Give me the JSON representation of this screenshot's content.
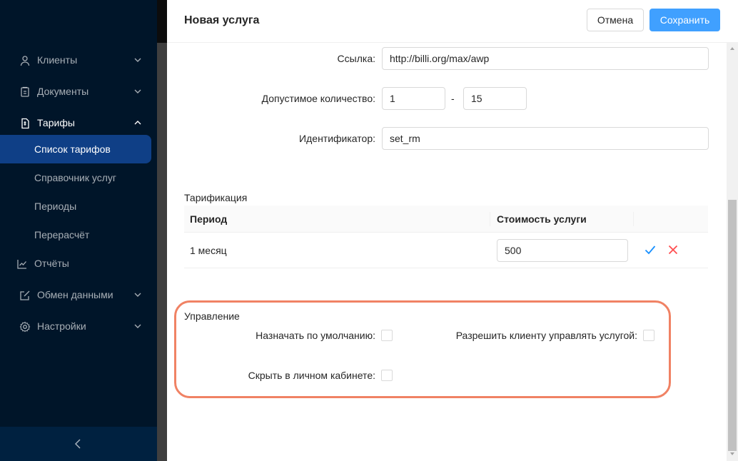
{
  "sidebar": {
    "items": [
      {
        "label": "Клиенты",
        "icon": "user-icon"
      },
      {
        "label": "Документы",
        "icon": "document-icon"
      },
      {
        "label": "Тарифы",
        "icon": "tariff-icon"
      },
      {
        "label": "Отчёты",
        "icon": "chart-icon"
      },
      {
        "label": "Обмен данными",
        "icon": "edit-icon"
      },
      {
        "label": "Настройки",
        "icon": "gear-icon"
      }
    ],
    "sub_items": [
      {
        "label": "Список тарифов",
        "active": true
      },
      {
        "label": "Справочник услуг"
      },
      {
        "label": "Периоды"
      },
      {
        "label": "Перерасчёт"
      }
    ],
    "collapse_icon": "chevron-left-icon"
  },
  "drawer": {
    "title": "Новая услуга",
    "cancel_label": "Отмена",
    "save_label": "Сохранить"
  },
  "form": {
    "link_label": "Ссылка:",
    "link_value": "http://billi.org/max/awp",
    "qty_label": "Допустимое количество:",
    "qty_min": "1",
    "qty_sep": "-",
    "qty_max": "15",
    "id_label": "Идентификатор:",
    "id_value": "set_rm"
  },
  "tariffing": {
    "title": "Тарификация",
    "columns": [
      "Период",
      "Стоимость услуги"
    ],
    "rows": [
      {
        "period": "1 месяц",
        "price": "500"
      }
    ]
  },
  "management": {
    "title": "Управление",
    "default_label": "Назначать по умолчанию:",
    "allow_client_label": "Разрешить клиенту управлять услугой:",
    "hide_label": "Скрыть в личном кабинете:"
  },
  "colors": {
    "sidebar_bg": "#001529",
    "primary": "#40a0ff",
    "highlight": "#f08264",
    "confirm": "#1890ff",
    "delete": "#ff4d4f"
  }
}
